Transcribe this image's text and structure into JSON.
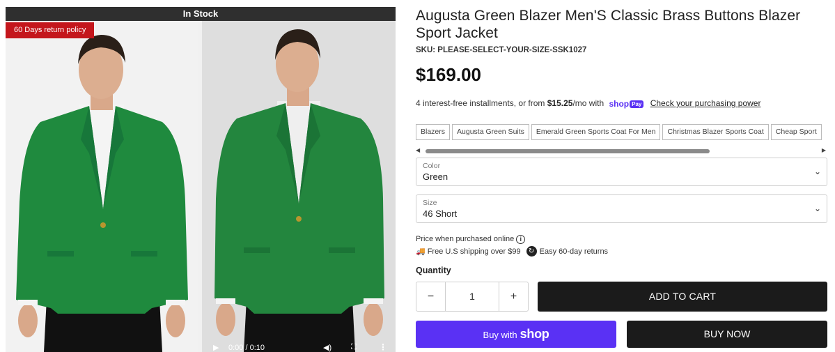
{
  "gallery": {
    "stock_status": "In Stock",
    "return_badge": "60 Days return policy",
    "video": {
      "time": "0:00 / 0:10"
    }
  },
  "product": {
    "title": "Augusta Green Blazer Men'S Classic Brass Buttons Blazer Sport Jacket",
    "sku": "SKU: PLEASE-SELECT-YOUR-SIZE-SSK1027",
    "price": "$169.00",
    "installments": {
      "prefix": "4 interest-free installments, or from ",
      "amount": "$15.25",
      "suffix": "/mo with",
      "shop_logo": "shop",
      "pay_pill": "Pay",
      "link": "Check your purchasing power"
    },
    "tags": [
      "Blazers",
      "Augusta Green Suits",
      "Emerald Green Sports Coat For Men",
      "Christmas Blazer Sports Coat",
      "Cheap Sport"
    ],
    "color_select": {
      "label": "Color",
      "value": "Green"
    },
    "size_select": {
      "label": "Size",
      "value": "46 Short"
    },
    "price_online": "Price when purchased online",
    "shipping": "Free U.S shipping over $99",
    "returns": "Easy 60-day returns",
    "quantity_label": "Quantity",
    "quantity": "1",
    "add_to_cart": "ADD TO CART",
    "buy_with": "Buy with",
    "shop_word": "shop",
    "buy_now": "BUY NOW"
  },
  "colors": {
    "blazer_green": "#1f8a3e",
    "shop_purple": "#5a31f4",
    "dark_button": "#1b1b1b",
    "badge_red": "#c4161c"
  }
}
